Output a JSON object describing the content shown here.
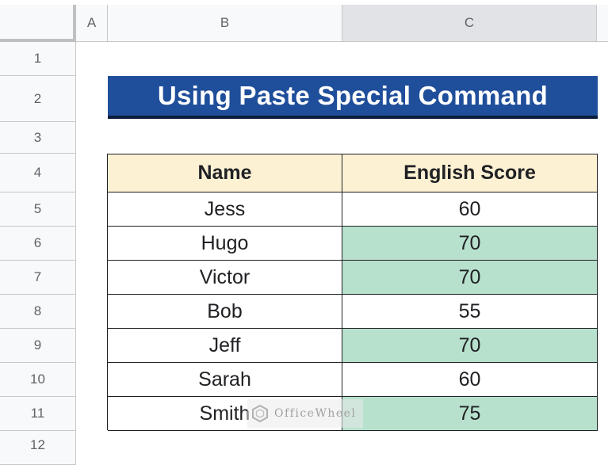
{
  "columns": [
    "A",
    "B",
    "C"
  ],
  "rows": [
    "1",
    "2",
    "3",
    "4",
    "5",
    "6",
    "7",
    "8",
    "9",
    "10",
    "11",
    "12"
  ],
  "title": "Using Paste Special Command",
  "table": {
    "headers": [
      "Name",
      "English Score"
    ],
    "rows": [
      {
        "name": "Jess",
        "score": "60"
      },
      {
        "name": "Hugo",
        "score": "70"
      },
      {
        "name": "Victor",
        "score": "70"
      },
      {
        "name": "Bob",
        "score": "55"
      },
      {
        "name": "Jeff",
        "score": "70"
      },
      {
        "name": "Sarah",
        "score": "60"
      },
      {
        "name": "Smith",
        "score": "75"
      }
    ]
  },
  "watermark": "OfficeWheel",
  "colors": {
    "title_bg": "#1f4e9a",
    "header_bg": "#fdf1d4",
    "highlight_green": "#b7e1cd"
  }
}
